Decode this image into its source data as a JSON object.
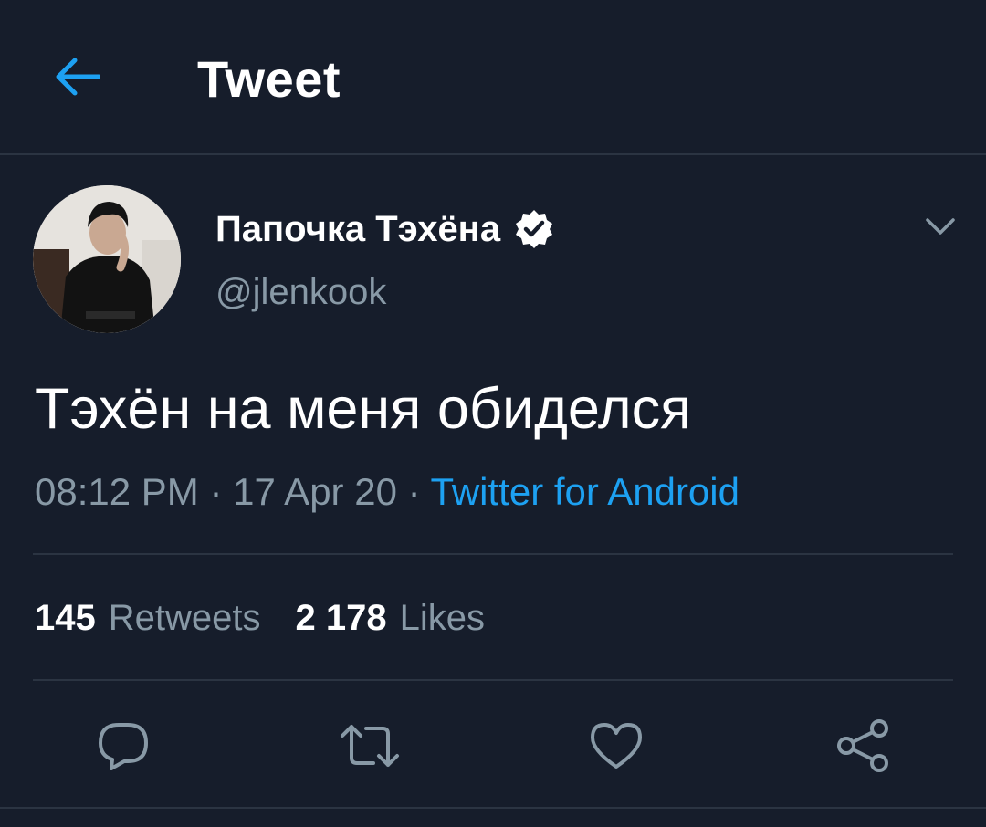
{
  "header": {
    "back_icon": "arrow-left-icon",
    "title": "Tweet"
  },
  "author": {
    "display_name": "Папочка Тэхёна",
    "handle": "@jlenkook",
    "verified_icon": "verified-badge-icon",
    "menu_icon": "chevron-down-icon"
  },
  "tweet": {
    "text": "Тэхён на меня обиделся",
    "time": "08:12 PM",
    "sep1": " · ",
    "date": "17 Apr 20",
    "sep2": " · ",
    "source": "Twitter for Android"
  },
  "stats": {
    "retweets_count": "145",
    "retweets_label": "Retweets",
    "likes_count": "2 178",
    "likes_label": "Likes"
  },
  "actions": [
    {
      "icon": "reply-icon"
    },
    {
      "icon": "retweet-icon"
    },
    {
      "icon": "like-icon"
    },
    {
      "icon": "share-icon"
    }
  ],
  "colors": {
    "background": "#161d2b",
    "accent": "#1da1f2",
    "secondary_text": "#8899a6",
    "divider": "#2b3442"
  }
}
